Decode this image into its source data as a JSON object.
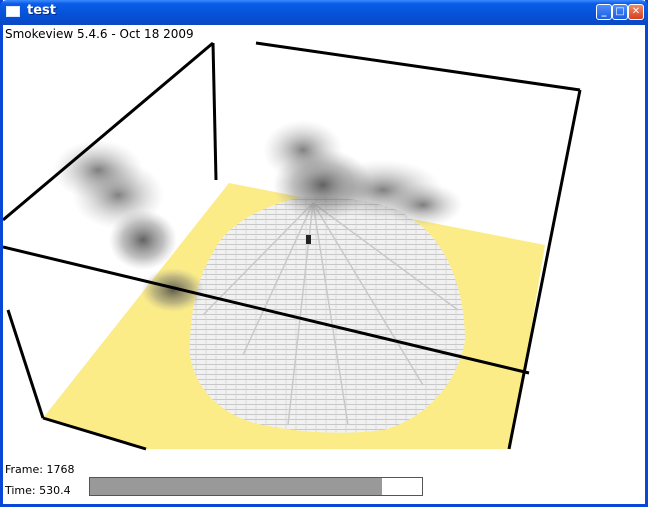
{
  "window": {
    "title": "test"
  },
  "titlebar_buttons": {
    "minimize": "_",
    "maximize": "□",
    "close": "✕"
  },
  "scene": {
    "version_text": "Smokeview 5.4.6 - Oct 18 2009",
    "frame_text": "Frame: 1768",
    "time_text": "Time: 530.4",
    "time_progress": 0.88,
    "colors": {
      "floor": "#fbec88",
      "fire": "#f2f2f2",
      "smoke": "#505050",
      "box": "#000000"
    }
  }
}
